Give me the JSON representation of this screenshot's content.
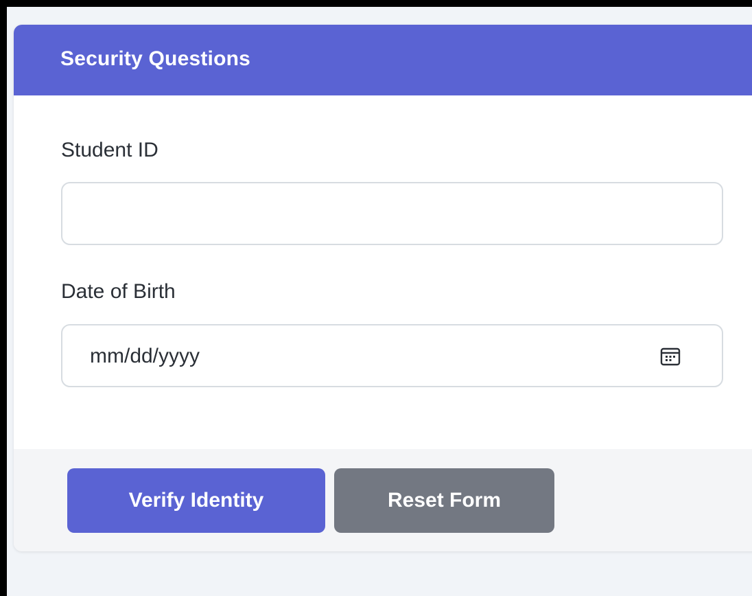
{
  "form": {
    "title": "Security Questions",
    "student_id": {
      "label": "Student ID",
      "value": ""
    },
    "date_of_birth": {
      "label": "Date of Birth",
      "placeholder": "mm/dd/yyyy",
      "icon": "calendar-icon"
    }
  },
  "actions": {
    "verify_label": "Verify Identity",
    "reset_label": "Reset Form"
  },
  "colors": {
    "primary": "#5a63d3",
    "secondary": "#737882",
    "page_background": "#f1f4f8",
    "footer_background": "#f4f5f7"
  }
}
